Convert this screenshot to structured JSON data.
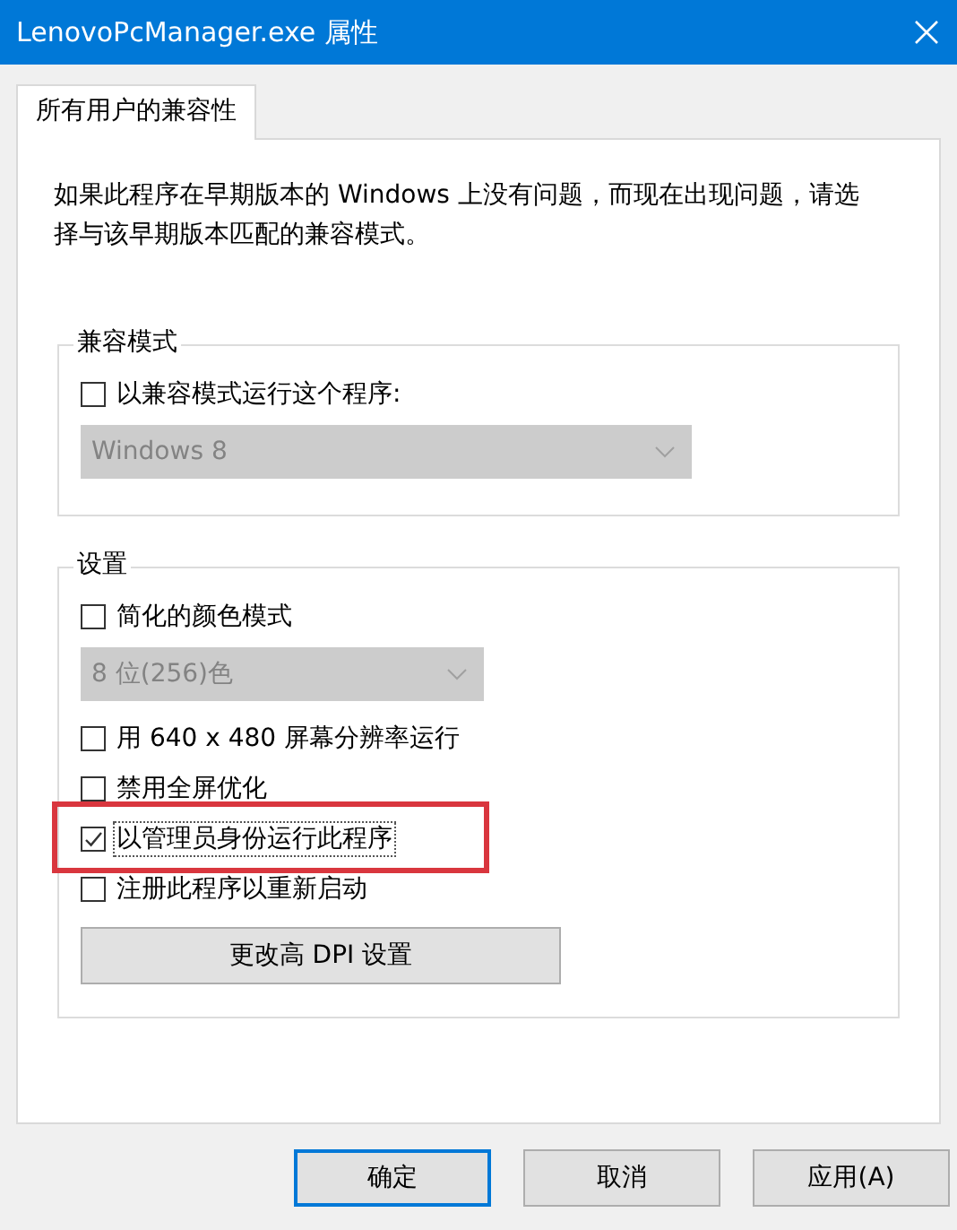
{
  "window": {
    "title": "LenovoPcManager.exe 属性"
  },
  "tabs": [
    {
      "label": "所有用户的兼容性",
      "selected": true
    }
  ],
  "description": "如果此程序在早期版本的 Windows 上没有问题，而现在出现问题，请选择与该早期版本匹配的兼容模式。",
  "groups": [
    {
      "title": "兼容模式",
      "items": [
        {
          "kind": "checkbox",
          "label": "以兼容模式运行这个程序:",
          "checked": false,
          "focused": false,
          "highlighted": false
        },
        {
          "kind": "dropdown",
          "value": "Windows 8",
          "disabled": true
        }
      ]
    },
    {
      "title": "设置",
      "items": [
        {
          "kind": "checkbox",
          "label": "简化的颜色模式",
          "checked": false,
          "focused": false,
          "highlighted": false
        },
        {
          "kind": "dropdown",
          "value": "8 位(256)色",
          "disabled": true
        },
        {
          "kind": "checkbox",
          "label": "用 640 x 480 屏幕分辨率运行",
          "checked": false,
          "focused": false,
          "highlighted": false
        },
        {
          "kind": "checkbox",
          "label": "禁用全屏优化",
          "checked": false,
          "focused": false,
          "highlighted": false
        },
        {
          "kind": "checkbox",
          "label": "以管理员身份运行此程序",
          "checked": true,
          "focused": true,
          "highlighted": true
        },
        {
          "kind": "checkbox",
          "label": "注册此程序以重新启动",
          "checked": false,
          "focused": false,
          "highlighted": false
        },
        {
          "kind": "button",
          "label": "更改高 DPI 设置"
        }
      ]
    }
  ],
  "buttons": [
    {
      "label": "确定",
      "default": true
    },
    {
      "label": "取消",
      "default": false
    },
    {
      "label": "应用(A)",
      "default": false
    }
  ]
}
